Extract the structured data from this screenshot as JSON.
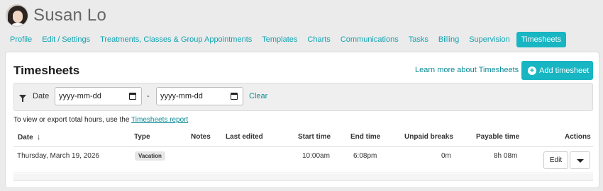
{
  "patient": {
    "name": "Susan Lo"
  },
  "tabs": [
    {
      "label": "Profile"
    },
    {
      "label": "Edit / Settings"
    },
    {
      "label": "Treatments, Classes & Group Appointments"
    },
    {
      "label": "Templates"
    },
    {
      "label": "Charts"
    },
    {
      "label": "Communications"
    },
    {
      "label": "Tasks"
    },
    {
      "label": "Billing"
    },
    {
      "label": "Supervision"
    },
    {
      "label": "Timesheets",
      "active": true
    }
  ],
  "timesheets": {
    "title": "Timesheets",
    "learn_more": "Learn more about Timesheets",
    "add_button": "Add timesheet",
    "filter": {
      "label": "Date",
      "from_placeholder": "yyyy-mm-dd",
      "to_placeholder": "yyyy-mm-dd",
      "separator": "-",
      "clear": "Clear"
    },
    "report_text": "To view or export total hours, use the",
    "report_link": "Timesheets report",
    "columns": [
      "Date",
      "Type",
      "Notes",
      "Last edited",
      "Start time",
      "End time",
      "Unpaid breaks",
      "Payable time",
      "Actions"
    ],
    "sort_arrow": "↓",
    "rows": [
      {
        "date": "Thursday, March 19, 2026",
        "type": "Vacation",
        "notes": "",
        "last_edited": "",
        "start_time": "10:00am",
        "end_time": "6:08pm",
        "unpaid_breaks": "0m",
        "payable_time": "8h 08m",
        "edit_label": "Edit"
      }
    ]
  },
  "colors": {
    "accent": "#18b5c2",
    "link": "#0c8b96"
  },
  "icons": {
    "filter": "filter-icon",
    "add": "plus-circle-icon",
    "calendar": "calendar-icon",
    "more": "caret-down-icon"
  }
}
